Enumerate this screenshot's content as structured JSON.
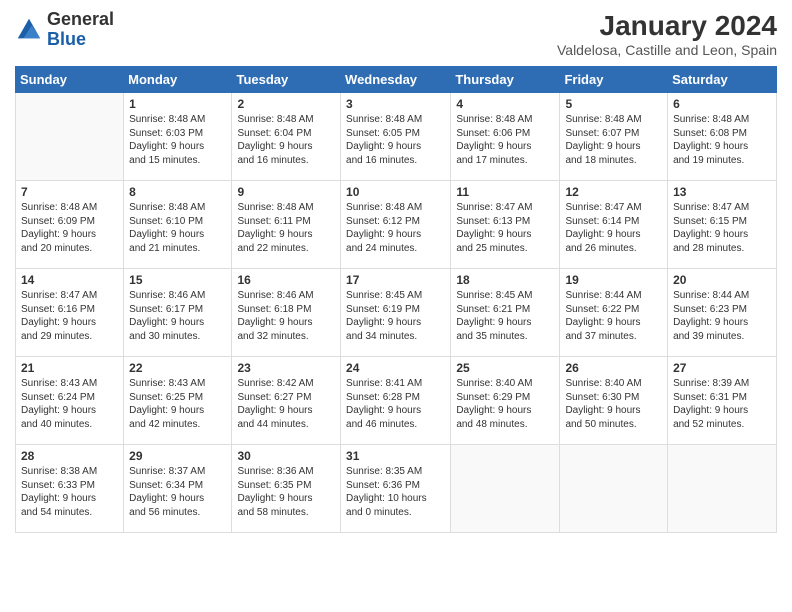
{
  "logo": {
    "line1": "General",
    "line2": "Blue"
  },
  "title": "January 2024",
  "subtitle": "Valdelosa, Castille and Leon, Spain",
  "header_days": [
    "Sunday",
    "Monday",
    "Tuesday",
    "Wednesday",
    "Thursday",
    "Friday",
    "Saturday"
  ],
  "weeks": [
    [
      {
        "num": "",
        "info": ""
      },
      {
        "num": "1",
        "info": "Sunrise: 8:48 AM\nSunset: 6:03 PM\nDaylight: 9 hours\nand 15 minutes."
      },
      {
        "num": "2",
        "info": "Sunrise: 8:48 AM\nSunset: 6:04 PM\nDaylight: 9 hours\nand 16 minutes."
      },
      {
        "num": "3",
        "info": "Sunrise: 8:48 AM\nSunset: 6:05 PM\nDaylight: 9 hours\nand 16 minutes."
      },
      {
        "num": "4",
        "info": "Sunrise: 8:48 AM\nSunset: 6:06 PM\nDaylight: 9 hours\nand 17 minutes."
      },
      {
        "num": "5",
        "info": "Sunrise: 8:48 AM\nSunset: 6:07 PM\nDaylight: 9 hours\nand 18 minutes."
      },
      {
        "num": "6",
        "info": "Sunrise: 8:48 AM\nSunset: 6:08 PM\nDaylight: 9 hours\nand 19 minutes."
      }
    ],
    [
      {
        "num": "7",
        "info": "Sunrise: 8:48 AM\nSunset: 6:09 PM\nDaylight: 9 hours\nand 20 minutes."
      },
      {
        "num": "8",
        "info": "Sunrise: 8:48 AM\nSunset: 6:10 PM\nDaylight: 9 hours\nand 21 minutes."
      },
      {
        "num": "9",
        "info": "Sunrise: 8:48 AM\nSunset: 6:11 PM\nDaylight: 9 hours\nand 22 minutes."
      },
      {
        "num": "10",
        "info": "Sunrise: 8:48 AM\nSunset: 6:12 PM\nDaylight: 9 hours\nand 24 minutes."
      },
      {
        "num": "11",
        "info": "Sunrise: 8:47 AM\nSunset: 6:13 PM\nDaylight: 9 hours\nand 25 minutes."
      },
      {
        "num": "12",
        "info": "Sunrise: 8:47 AM\nSunset: 6:14 PM\nDaylight: 9 hours\nand 26 minutes."
      },
      {
        "num": "13",
        "info": "Sunrise: 8:47 AM\nSunset: 6:15 PM\nDaylight: 9 hours\nand 28 minutes."
      }
    ],
    [
      {
        "num": "14",
        "info": "Sunrise: 8:47 AM\nSunset: 6:16 PM\nDaylight: 9 hours\nand 29 minutes."
      },
      {
        "num": "15",
        "info": "Sunrise: 8:46 AM\nSunset: 6:17 PM\nDaylight: 9 hours\nand 30 minutes."
      },
      {
        "num": "16",
        "info": "Sunrise: 8:46 AM\nSunset: 6:18 PM\nDaylight: 9 hours\nand 32 minutes."
      },
      {
        "num": "17",
        "info": "Sunrise: 8:45 AM\nSunset: 6:19 PM\nDaylight: 9 hours\nand 34 minutes."
      },
      {
        "num": "18",
        "info": "Sunrise: 8:45 AM\nSunset: 6:21 PM\nDaylight: 9 hours\nand 35 minutes."
      },
      {
        "num": "19",
        "info": "Sunrise: 8:44 AM\nSunset: 6:22 PM\nDaylight: 9 hours\nand 37 minutes."
      },
      {
        "num": "20",
        "info": "Sunrise: 8:44 AM\nSunset: 6:23 PM\nDaylight: 9 hours\nand 39 minutes."
      }
    ],
    [
      {
        "num": "21",
        "info": "Sunrise: 8:43 AM\nSunset: 6:24 PM\nDaylight: 9 hours\nand 40 minutes."
      },
      {
        "num": "22",
        "info": "Sunrise: 8:43 AM\nSunset: 6:25 PM\nDaylight: 9 hours\nand 42 minutes."
      },
      {
        "num": "23",
        "info": "Sunrise: 8:42 AM\nSunset: 6:27 PM\nDaylight: 9 hours\nand 44 minutes."
      },
      {
        "num": "24",
        "info": "Sunrise: 8:41 AM\nSunset: 6:28 PM\nDaylight: 9 hours\nand 46 minutes."
      },
      {
        "num": "25",
        "info": "Sunrise: 8:40 AM\nSunset: 6:29 PM\nDaylight: 9 hours\nand 48 minutes."
      },
      {
        "num": "26",
        "info": "Sunrise: 8:40 AM\nSunset: 6:30 PM\nDaylight: 9 hours\nand 50 minutes."
      },
      {
        "num": "27",
        "info": "Sunrise: 8:39 AM\nSunset: 6:31 PM\nDaylight: 9 hours\nand 52 minutes."
      }
    ],
    [
      {
        "num": "28",
        "info": "Sunrise: 8:38 AM\nSunset: 6:33 PM\nDaylight: 9 hours\nand 54 minutes."
      },
      {
        "num": "29",
        "info": "Sunrise: 8:37 AM\nSunset: 6:34 PM\nDaylight: 9 hours\nand 56 minutes."
      },
      {
        "num": "30",
        "info": "Sunrise: 8:36 AM\nSunset: 6:35 PM\nDaylight: 9 hours\nand 58 minutes."
      },
      {
        "num": "31",
        "info": "Sunrise: 8:35 AM\nSunset: 6:36 PM\nDaylight: 10 hours\nand 0 minutes."
      },
      {
        "num": "",
        "info": ""
      },
      {
        "num": "",
        "info": ""
      },
      {
        "num": "",
        "info": ""
      }
    ]
  ]
}
